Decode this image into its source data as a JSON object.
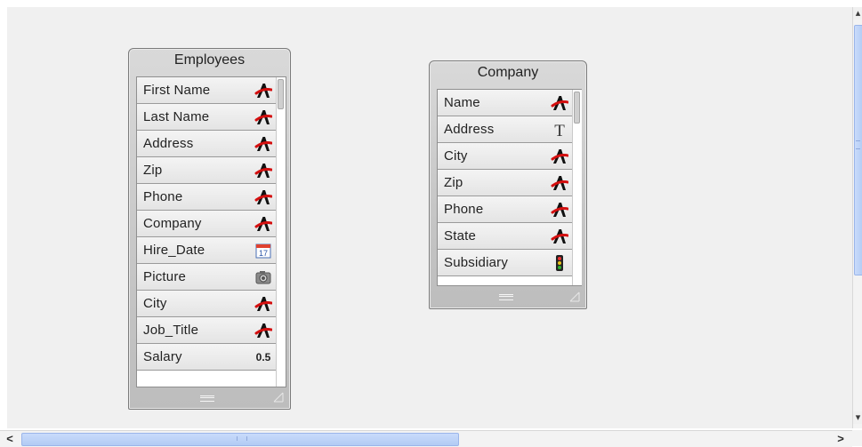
{
  "tables": [
    {
      "title": "Employees",
      "fields": [
        {
          "name": "First Name",
          "icon": "text-field-icon"
        },
        {
          "name": "Last Name",
          "icon": "text-field-icon"
        },
        {
          "name": "Address",
          "icon": "text-field-icon"
        },
        {
          "name": "Zip",
          "icon": "text-field-icon"
        },
        {
          "name": "Phone",
          "icon": "text-field-icon"
        },
        {
          "name": "Company",
          "icon": "text-field-icon"
        },
        {
          "name": "Hire_Date",
          "icon": "date-field-icon"
        },
        {
          "name": "Picture",
          "icon": "picture-field-icon"
        },
        {
          "name": "City",
          "icon": "text-field-icon"
        },
        {
          "name": "Job_Title",
          "icon": "text-field-icon"
        },
        {
          "name": "Salary",
          "icon": "number-field-icon",
          "icon_text": "0.5"
        }
      ]
    },
    {
      "title": "Company",
      "fields": [
        {
          "name": "Name",
          "icon": "text-field-icon"
        },
        {
          "name": "Address",
          "icon": "text-blob-field-icon",
          "icon_text": "T"
        },
        {
          "name": "City",
          "icon": "text-field-icon"
        },
        {
          "name": "Zip",
          "icon": "text-field-icon"
        },
        {
          "name": "Phone",
          "icon": "text-field-icon"
        },
        {
          "name": "State",
          "icon": "text-field-icon"
        },
        {
          "name": "Subsidiary",
          "icon": "boolean-field-icon"
        }
      ]
    }
  ],
  "calendar_day": "17",
  "colors": {
    "text_icon_red": "#d40f0f",
    "canvas_bg": "#f0f0f0",
    "scroll_thumb": "#b9cff6"
  }
}
